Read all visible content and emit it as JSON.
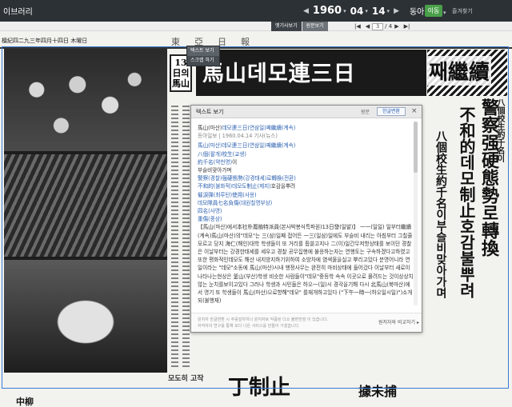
{
  "app": {
    "brand": "이브러리"
  },
  "date_nav": {
    "prev": "◀",
    "year": "1960",
    "month": "04",
    "day": "14",
    "next": "▶",
    "caret": "▾"
  },
  "paper": {
    "name": "동아일보",
    "caret": "▾"
  },
  "go_button": "이동",
  "bookmark": "즐겨찾기",
  "toolbar": {
    "tabs": [
      "옛기사보기",
      "원문보기"
    ],
    "pager": {
      "first": "|◀",
      "prev": "◀",
      "current": "3",
      "total": "/ 4",
      "next": "▶",
      "last": "▶|"
    }
  },
  "view_menu": {
    "items": [
      "텍스트 보기",
      "스크랩 하기"
    ]
  },
  "newspaper": {
    "masthead_date": "檀紀四二九三年四月十四日 木曜日",
    "masthead_name": "東亞日報",
    "side_title": "13日의馬山",
    "headline": "馬山데모連三日",
    "headline_tail": "째繼續",
    "bg_col1": "警察强硬態勢로轉換",
    "bg_col2": "不和的데모制止호감불뿌려",
    "bg_col3": "八個校生約千名이부슬비맞아가며",
    "bg_kicker": "八個校生約千名이",
    "bottom_big": "丁制止",
    "bottom_mid": "據未捕",
    "bottom_small": "모도히 고작",
    "bottom_left": "中柳"
  },
  "dialog": {
    "title": "텍스트 보기",
    "orig_label": "원문",
    "convert_label": "한글변환",
    "close": "×",
    "article_title": [
      "馬山(마산)",
      "데모連三日(연삼일)",
      "째繼續(계속)"
    ],
    "meta": "동아일보 | 1960.04.14 기사(뉴스)",
    "lines": [
      [
        "馬山(마산)",
        "데모連三日(연삼일)",
        "째繼續(계속)"
      ],
      [
        "八個(팔개)",
        "校生(교생)"
      ],
      [
        "約千名(약천명)",
        "이"
      ],
      [
        "부슬비맞아가며"
      ],
      [
        "警察(경찰)",
        "强硬態勢(강경태세)",
        "로轉換(전환)"
      ],
      [
        "不和的(불화적)",
        "데모도制止(제지)",
        "호감을뿌려"
      ],
      [
        "催淚彈(최루탄)",
        "使用(사용)"
      ],
      [
        "데모隊員七名負傷(대원칠명부상)"
      ],
      [
        "四名(사명)"
      ],
      [
        "重傷(중상)"
      ]
    ],
    "paragraph": "【馬山(마산)에서本社朴鳳植特派員(본사박봉식특파원)13日發(일발)】 一一(일일) 일부터繼續(계속)馬山(마산)의\"데모\"는 三(삼)일째 접어든 一三(일삼)일에도 부슬비 내리는 아침부터 그칠줄모르고 당지 海仁(해인)대학 학생들이 또 거리를 휩쓸고지나 二(이)일간무저항상태를 보이던 경찰은 이날부터는 강경한태세를 세우고 경찰 공무집행에 불응하는자는 연행토는 구속하겠다고하였고 또한 평화적인데모도 해산 내지방지하기위하여 소방차에 염색물을실고 뿌리고있다 분명어니라 연일이라는 \"데모\"소동에 馬山(마산)시내 행정사무는 완전히 마비상태에 들어갔다 이날부터 새로이 나타나는현상은 釜山(부산)학생 비슷한 사람들이\"데모\"중등학 속속 이곳으로 몰려드는 것이상상치않는 눈치를보이고있다 그러나 학생과 시민들은 하오一(일)시 경각을기해 다시 北馬山(북마산)에서 명기 또 학생들이 馬山(마산)으로향해\"데모\" 를재개하고있다 (\"下午一時一(하오일시일)\")소개되(불행재)",
    "notice1": "원저자 한글변환 시 주를앞차하나 원저자로 작품된 다소 불편한점 이 있습니다.",
    "notice2": "저작자의 연구를 통해 보다 나은 서비스를 만들어 가겠습니다.",
    "report": "원저자와 비교하기 ▸"
  },
  "colors": {
    "topbar": "#2c3136",
    "accent_green": "#4aa04a",
    "link_blue": "#2a5fb0",
    "frame_blue": "#3a7bd5"
  }
}
